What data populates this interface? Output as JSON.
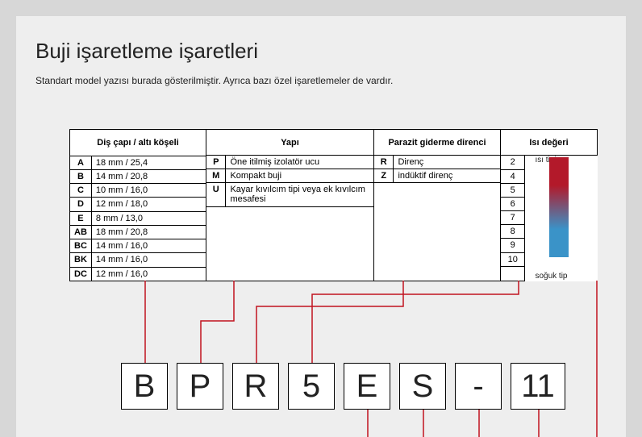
{
  "title": "Buji işaretleme işaretleri",
  "subtitle": "Standart model yazısı burada gösterilmiştir. Ayrıca bazı özel işaretlemeler de vardır.",
  "columns": {
    "thread": {
      "header": "Diş çapı /\naltı köşeli",
      "rows": [
        {
          "code": "A",
          "value": "18 mm / 25,4"
        },
        {
          "code": "B",
          "value": "14 mm / 20,8"
        },
        {
          "code": "C",
          "value": "10 mm / 16,0"
        },
        {
          "code": "D",
          "value": "12 mm / 18,0"
        },
        {
          "code": "E",
          "value": "  8 mm / 13,0"
        },
        {
          "code": "AB",
          "value": "18 mm / 20,8"
        },
        {
          "code": "BC",
          "value": "14 mm / 16,0"
        },
        {
          "code": "BK",
          "value": "14 mm / 16,0"
        },
        {
          "code": "DC",
          "value": "12 mm / 16,0"
        }
      ]
    },
    "construction": {
      "header": "Yapı",
      "rows": [
        {
          "code": "P",
          "value": "Öne itilmiş izolatör ucu"
        },
        {
          "code": "M",
          "value": "Kompakt buji"
        },
        {
          "code": "U",
          "value": "Kayar kıvılcım tipi veya ek kıvılcım mesafesi"
        }
      ]
    },
    "resistor": {
      "header": "Parazit giderme direnci",
      "rows": [
        {
          "code": "R",
          "value": "Direnç"
        },
        {
          "code": "Z",
          "value": "indüktif direnç"
        }
      ]
    },
    "heat": {
      "header": "Isı değeri",
      "numbers": [
        "2",
        "4",
        "5",
        "6",
        "7",
        "8",
        "9",
        "10"
      ],
      "hot_label": "ısı tipi",
      "cold_label": "soğuk tip"
    }
  },
  "example_code": [
    "B",
    "P",
    "R",
    "5",
    "E",
    "S",
    "-",
    "11"
  ]
}
